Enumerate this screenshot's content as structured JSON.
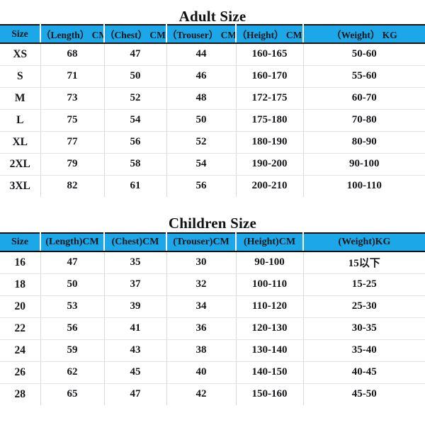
{
  "adult": {
    "title": "Adult Size",
    "columns": [
      "Size",
      "（Length） CM",
      "（Chest） CM",
      "（Trouser） CM",
      "（Height） CM",
      "（Weight） KG"
    ],
    "rows": [
      {
        "size": "XS",
        "length": "68",
        "chest": "47",
        "trouser": "44",
        "height": "160-165",
        "weight": "50-60"
      },
      {
        "size": "S",
        "length": "71",
        "chest": "50",
        "trouser": "46",
        "height": "160-170",
        "weight": "55-60"
      },
      {
        "size": "M",
        "length": "73",
        "chest": "52",
        "trouser": "48",
        "height": "172-175",
        "weight": "60-70"
      },
      {
        "size": "L",
        "length": "75",
        "chest": "54",
        "trouser": "50",
        "height": "175-180",
        "weight": "70-80"
      },
      {
        "size": "XL",
        "length": "77",
        "chest": "56",
        "trouser": "52",
        "height": "180-190",
        "weight": "80-90"
      },
      {
        "size": "2XL",
        "length": "79",
        "chest": "58",
        "trouser": "54",
        "height": "190-200",
        "weight": "90-100"
      },
      {
        "size": "3XL",
        "length": "82",
        "chest": "61",
        "trouser": "56",
        "height": "200-210",
        "weight": "100-110"
      }
    ]
  },
  "children": {
    "title": "Children Size",
    "columns": [
      "Size",
      "(Length)CM",
      "(Chest)CM",
      "(Trouser)CM",
      "(Height)CM",
      "(Weight)KG"
    ],
    "rows": [
      {
        "size": "16",
        "length": "47",
        "chest": "35",
        "trouser": "30",
        "height": "90-100",
        "weight": "15以下"
      },
      {
        "size": "18",
        "length": "50",
        "chest": "37",
        "trouser": "32",
        "height": "100-110",
        "weight": "15-25"
      },
      {
        "size": "20",
        "length": "53",
        "chest": "39",
        "trouser": "34",
        "height": "110-120",
        "weight": "25-30"
      },
      {
        "size": "22",
        "length": "56",
        "chest": "41",
        "trouser": "36",
        "height": "120-130",
        "weight": "30-35"
      },
      {
        "size": "24",
        "length": "59",
        "chest": "43",
        "trouser": "38",
        "height": "130-140",
        "weight": "35-40"
      },
      {
        "size": "26",
        "length": "62",
        "chest": "45",
        "trouser": "40",
        "height": "140-150",
        "weight": "40-45"
      },
      {
        "size": "28",
        "length": "65",
        "chest": "47",
        "trouser": "42",
        "height": "150-160",
        "weight": "45-50"
      }
    ]
  },
  "colors": {
    "header_cyan": "#1CA8E8",
    "text": "#15161a",
    "grid": "#d8dade",
    "background": "#ffffff"
  }
}
